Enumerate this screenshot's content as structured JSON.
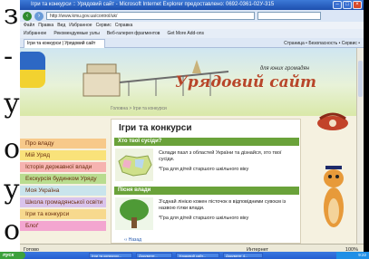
{
  "side_letters": [
    "з",
    "-",
    "у",
    "о",
    "у",
    "о"
  ],
  "browser": {
    "title": "Ігри та конкурси :: Урядовий сайт - Microsoft Internet Explorer предоставлено: 0692-0361-02У-315",
    "url": "http://www.kmu.gov.ua/control/uk/",
    "menu": [
      "Файл",
      "Правка",
      "Вид",
      "Избранное",
      "Сервис",
      "Справка"
    ],
    "favorites": [
      "Избранное",
      "Рекомендуемые узлы",
      "Веб-галерея фрагментов",
      "Get More Add-ons"
    ],
    "tab_label": "Ігри та конкурси | Урядовий сайт",
    "tools": "Страница • Безопасность • Сервис •"
  },
  "site": {
    "subtitle": "для юних громадян",
    "title": "Урядовий сайт",
    "breadcrumb": "Головна > Ігри та конкурси"
  },
  "leftnav": [
    {
      "label": "Про владу",
      "color": "#f7c98a"
    },
    {
      "label": "Мій Уряд",
      "color": "#f9e27a"
    },
    {
      "label": "Історія державної влади",
      "color": "#f6b3b0"
    },
    {
      "label": "Екскурсія будинком Уряду",
      "color": "#b9dc8f"
    },
    {
      "label": "Моя Україна",
      "color": "#c9e4ec"
    },
    {
      "label": "Школа громадянської освіти",
      "color": "#d9c3ec"
    },
    {
      "label": "Ігри та конкурси",
      "color": "#f7d98e"
    },
    {
      "label": "Блоґ",
      "color": "#f3a6d0"
    }
  ],
  "content": {
    "title": "Ігри та конкурси",
    "games": [
      {
        "heading": "Хто твої сусіди?",
        "text": "Склади пазл з областей України та дізнайся, хто твої сусіди.",
        "note": "*Гра для дітей старшого шкільного віку"
      },
      {
        "heading": "Пісня влади",
        "text": "З'єднай лінією кожен пісточок в відповідними сувоєм із назвою гілки влади.",
        "note": "*Гра для дітей старшого шкільного віку"
      }
    ],
    "more": "‹‹ Назад"
  },
  "status": {
    "left": "Готово",
    "zone": "Интернет",
    "zoom": "100%"
  },
  "taskbar": {
    "start": "пуск",
    "tasks": [
      "Ігри та конкурси...",
      "Документ...",
      "Урядовий сайт...",
      "Документ 4..."
    ],
    "clock": "9:22"
  }
}
